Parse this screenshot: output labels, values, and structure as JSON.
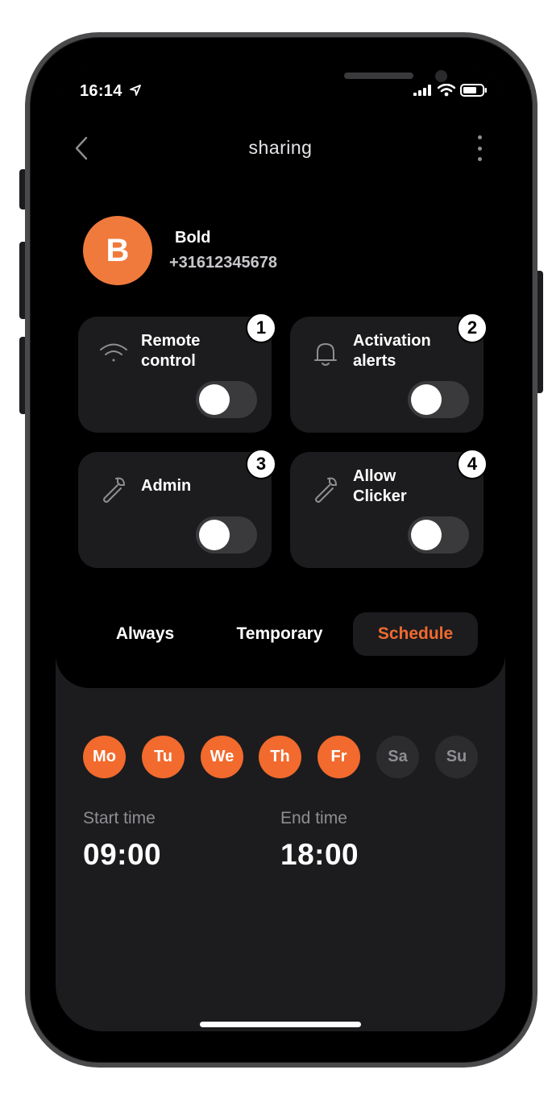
{
  "status_bar": {
    "time": "16:14"
  },
  "header": {
    "title": "sharing"
  },
  "profile": {
    "initial": "B",
    "name": "Bold",
    "phone": "+31612345678"
  },
  "permissions": [
    {
      "badge": "1",
      "label": "Remote\ncontrol",
      "icon": "wifi-icon",
      "enabled": false
    },
    {
      "badge": "2",
      "label": "Activation\nalerts",
      "icon": "bell-icon",
      "enabled": false
    },
    {
      "badge": "3",
      "label": "Admin",
      "icon": "wrench-icon",
      "enabled": false
    },
    {
      "badge": "4",
      "label": "Allow\nClicker",
      "icon": "wrench-icon",
      "enabled": false
    }
  ],
  "modes": {
    "always": "Always",
    "temporary": "Temporary",
    "schedule": "Schedule",
    "active": "schedule"
  },
  "schedule": {
    "days": [
      {
        "label": "Mo",
        "active": true
      },
      {
        "label": "Tu",
        "active": true
      },
      {
        "label": "We",
        "active": true
      },
      {
        "label": "Th",
        "active": true
      },
      {
        "label": "Fr",
        "active": true
      },
      {
        "label": "Sa",
        "active": false
      },
      {
        "label": "Su",
        "active": false
      }
    ],
    "start_label": "Start time",
    "start_value": "09:00",
    "end_label": "End time",
    "end_value": "18:00"
  },
  "colors": {
    "accent": "#f26a2d",
    "avatar": "#f07a3c",
    "card": "#1c1c1e",
    "background": "#000000"
  }
}
